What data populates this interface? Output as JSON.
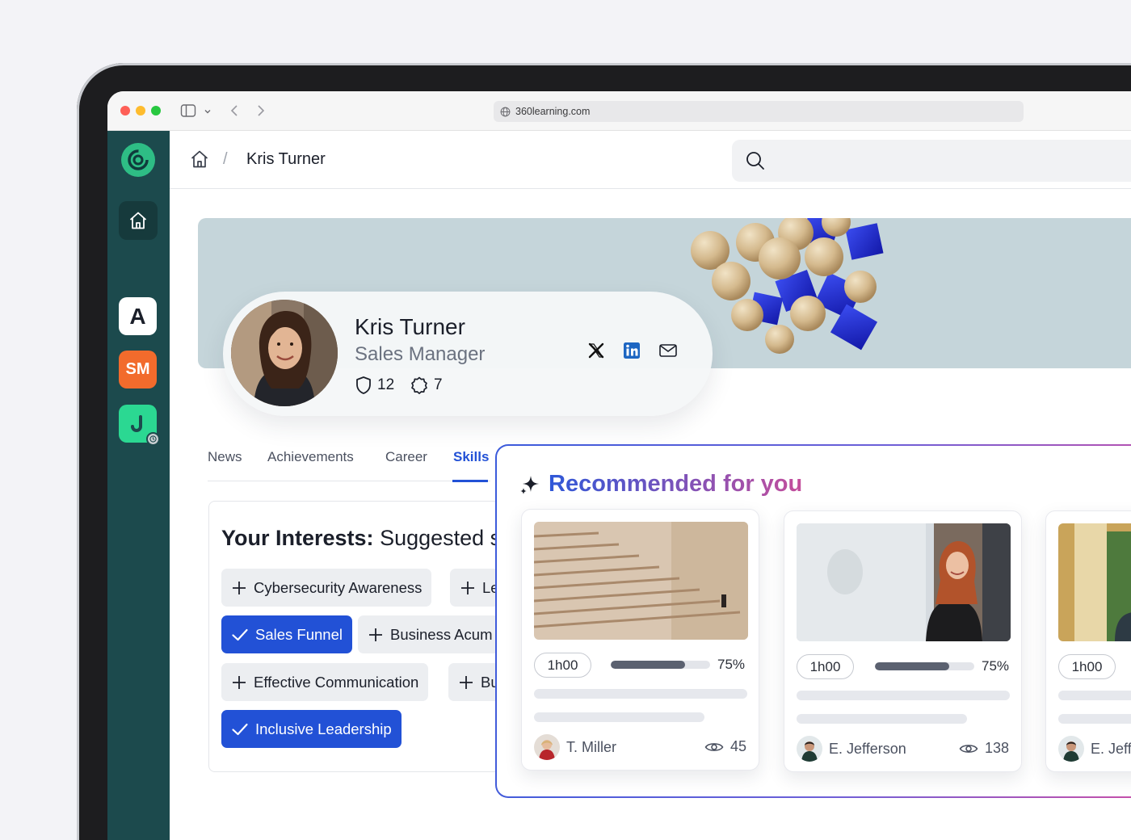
{
  "browser": {
    "url": "360learning.com"
  },
  "sidebar": {
    "apps": [
      {
        "label": "A",
        "bg": "#ffffff",
        "fg": "#1b1f2a"
      },
      {
        "label": "SM",
        "bg": "#f26b2c",
        "fg": "#ffffff"
      },
      {
        "label": "J",
        "bg": "#2bd892",
        "fg": "#1c4a4d"
      }
    ]
  },
  "header": {
    "breadcrumb_sep": "/",
    "title": "Kris Turner"
  },
  "profile": {
    "name": "Kris Turner",
    "role": "Sales Manager",
    "badges_count": "12",
    "certificates_count": "7"
  },
  "tabs": [
    {
      "label": "News"
    },
    {
      "label": "Achievements"
    },
    {
      "label": "Career"
    },
    {
      "label": "Skills",
      "active": true
    }
  ],
  "interests": {
    "title_bold": "Your Interests:",
    "title_rest": "Suggested s",
    "chips": [
      {
        "label": "Cybersecurity Awareness",
        "selected": false
      },
      {
        "label": "Le",
        "selected": false
      },
      {
        "label": "Sales Funnel",
        "selected": true
      },
      {
        "label": "Business Acum",
        "selected": false
      },
      {
        "label": "Effective Communication",
        "selected": false
      },
      {
        "label": "Bu",
        "selected": false
      },
      {
        "label": "Inclusive Leadership",
        "selected": true
      }
    ]
  },
  "recommended": {
    "title": "Recommended for you",
    "cards": [
      {
        "duration": "1h00",
        "progress_pct": 75,
        "progress_label": "75%",
        "author": "T. Miller",
        "views": "45"
      },
      {
        "duration": "1h00",
        "progress_pct": 75,
        "progress_label": "75%",
        "author": "E. Jefferson",
        "views": "138"
      },
      {
        "duration": "1h00",
        "author": "E. Jeff"
      }
    ]
  },
  "colors": {
    "sidebar": "#1c4a4d",
    "accent": "#2251d6",
    "brand_green": "#2ebd85"
  }
}
